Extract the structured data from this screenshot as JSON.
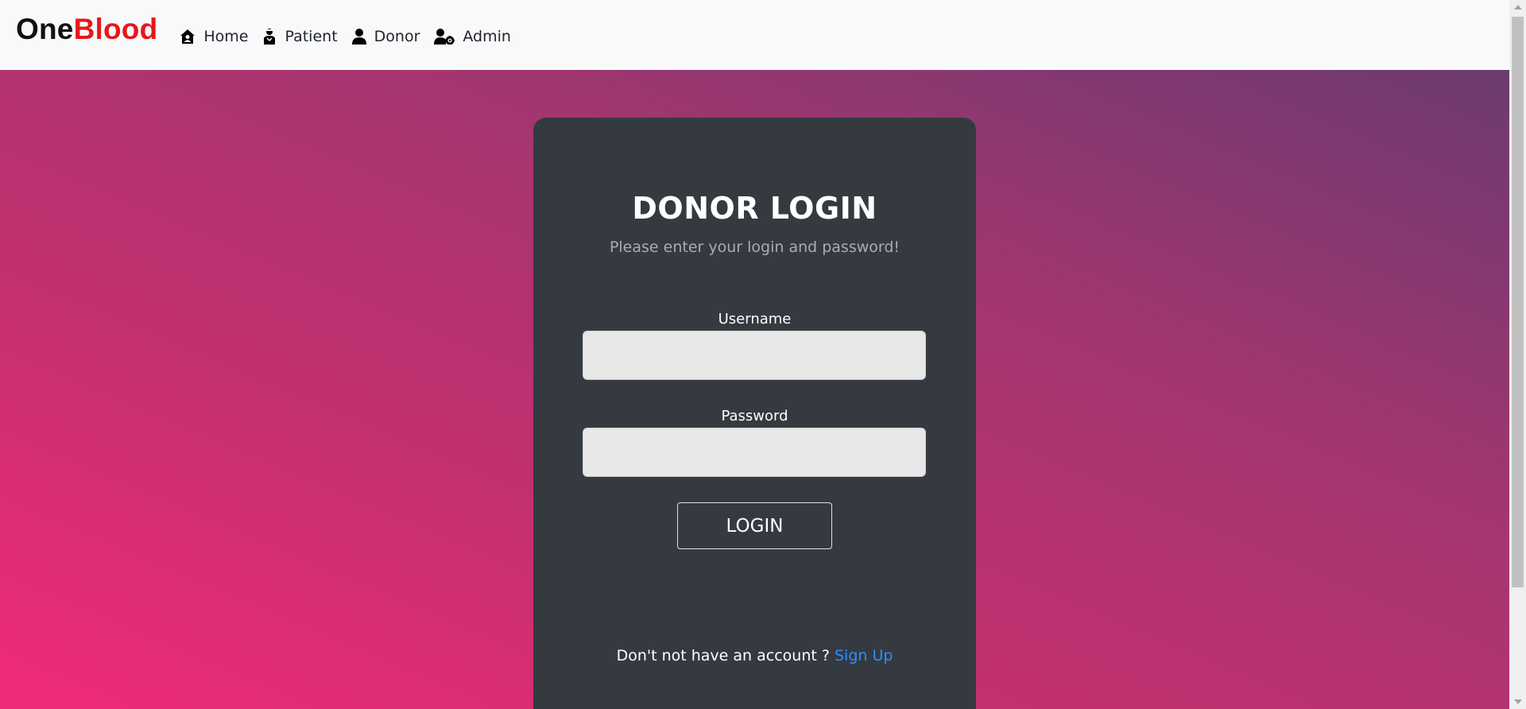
{
  "navbar": {
    "brand_part1": "One",
    "brand_part2": "Blood",
    "items": [
      {
        "label": "Home",
        "icon": "house-user-icon"
      },
      {
        "label": "Patient",
        "icon": "patient-icon"
      },
      {
        "label": "Donor",
        "icon": "user-icon"
      },
      {
        "label": "Admin",
        "icon": "user-cog-icon"
      }
    ]
  },
  "login": {
    "title": "DONOR LOGIN",
    "subtitle": "Please enter your login and password!",
    "username_label": "Username",
    "username_value": "",
    "password_label": "Password",
    "password_value": "",
    "button_label": "LOGIN",
    "signup_prompt": "Don't not have an account ?",
    "signup_link": "Sign Up"
  },
  "colors": {
    "brand_red": "#e8161a",
    "card_bg": "#343a40",
    "link_blue": "#2f8cff",
    "gradient_start": "#f12a7a",
    "gradient_end": "#6c3a70"
  }
}
